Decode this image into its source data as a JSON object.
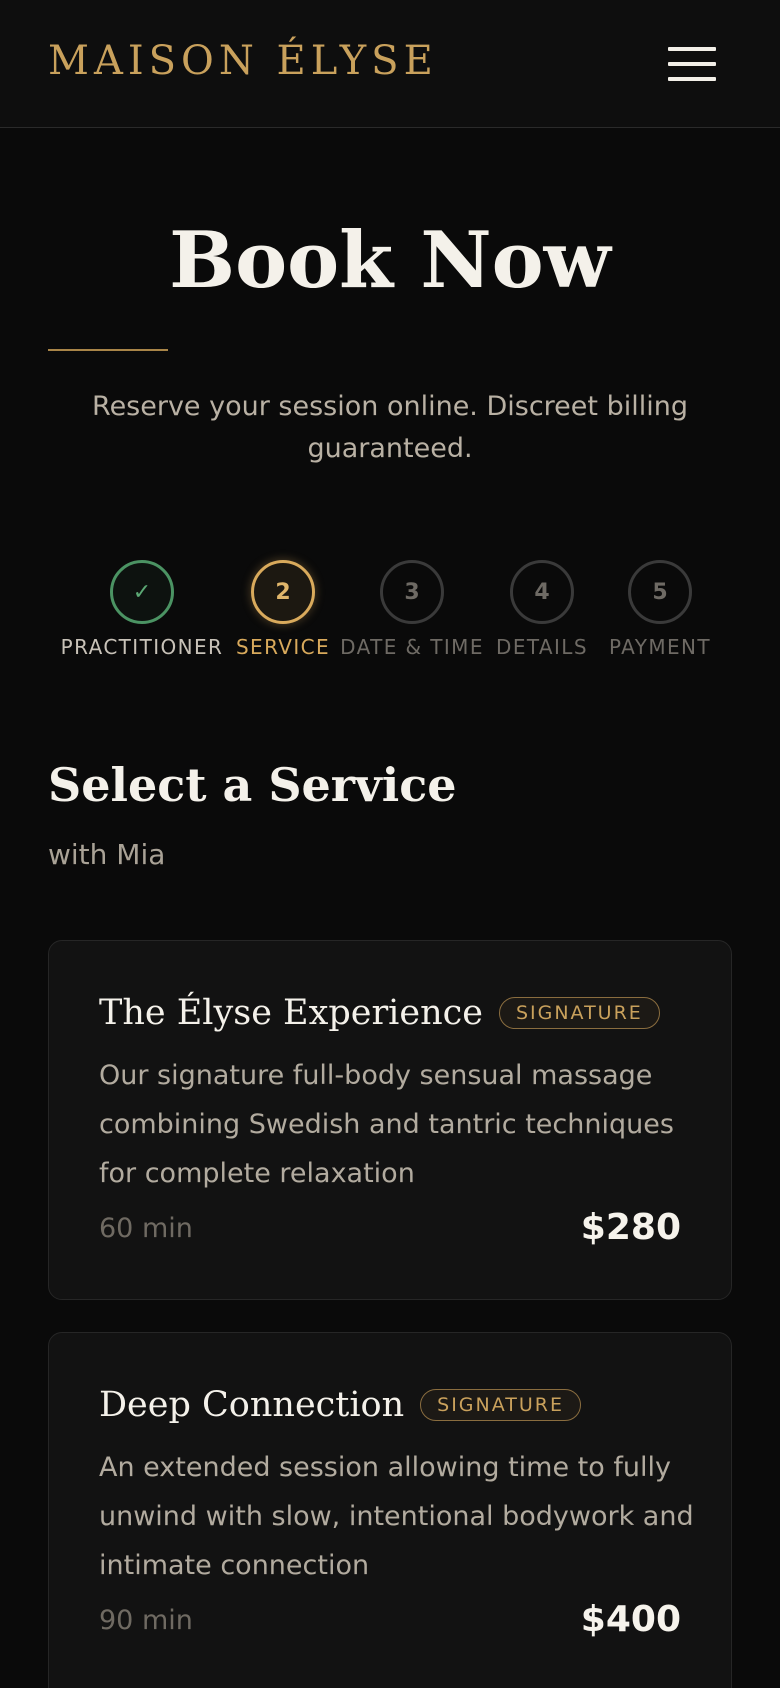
{
  "header": {
    "brand": "MAISON ÉLYSE",
    "menu_icon": "hamburger-menu-icon"
  },
  "hero": {
    "title": "Book Now",
    "subtitle": "Reserve your session online. Discreet billing guaranteed."
  },
  "stepper": {
    "steps": [
      {
        "marker": "✓",
        "label": "PRACTITIONER",
        "state": "complete"
      },
      {
        "marker": "2",
        "label": "SERVICE",
        "state": "active"
      },
      {
        "marker": "3",
        "label": "DATE & TIME",
        "state": "upcoming"
      },
      {
        "marker": "4",
        "label": "DETAILS",
        "state": "upcoming"
      },
      {
        "marker": "5",
        "label": "PAYMENT",
        "state": "upcoming"
      }
    ]
  },
  "section": {
    "title": "Select a Service",
    "subtitle": "with Mia"
  },
  "services": [
    {
      "name": "The Élyse Experience",
      "badge": "SIGNATURE",
      "description": "Our signature full-body sensual massage combining Swedish and tantric techniques for complete relaxation",
      "duration": "60 min",
      "price": "$280"
    },
    {
      "name": "Deep Connection",
      "badge": "SIGNATURE",
      "description": "An extended session allowing time to fully unwind with slow, intentional bodywork and intimate connection",
      "duration": "90 min",
      "price": "$400"
    }
  ],
  "colors": {
    "background": "#0a0a0a",
    "accent_gold": "#c9a15c",
    "complete_green": "#4b9363",
    "text_light": "#f4f1ea"
  }
}
